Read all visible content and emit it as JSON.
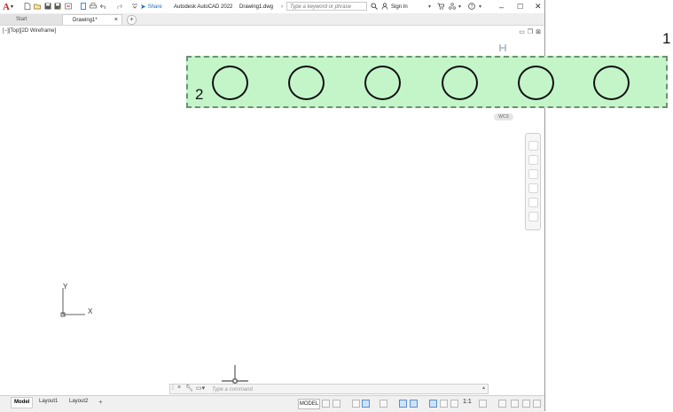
{
  "titlebar": {
    "app_name": "Autodesk AutoCAD 2022",
    "file_name": "Drawing1.dwg",
    "share_label": "Share",
    "search_placeholder": "Type a keyword or phrase",
    "sign_in_label": "Sign In"
  },
  "tabs": [
    {
      "label": "Start"
    },
    {
      "label": "Drawing1*"
    }
  ],
  "viewport": {
    "label": "[−][Top][2D Wireframe]",
    "wcs_label": "WCS"
  },
  "annotations": {
    "marker_1": "1",
    "marker_2": "2"
  },
  "drawing": {
    "circle_count": 6,
    "selection_fill_color": "#c3f5c9"
  },
  "ucs": {
    "x_label": "X",
    "y_label": "Y"
  },
  "commandline": {
    "placeholder": "Type a command"
  },
  "statusbar": {
    "layout_tabs": [
      {
        "label": "Model"
      },
      {
        "label": "Layout1"
      },
      {
        "label": "Layout2"
      }
    ],
    "model_label": "MODEL",
    "scale_label": "1:1"
  },
  "colors": {
    "autocad_red": "#c1272d",
    "share_blue": "#1f6fc5"
  }
}
